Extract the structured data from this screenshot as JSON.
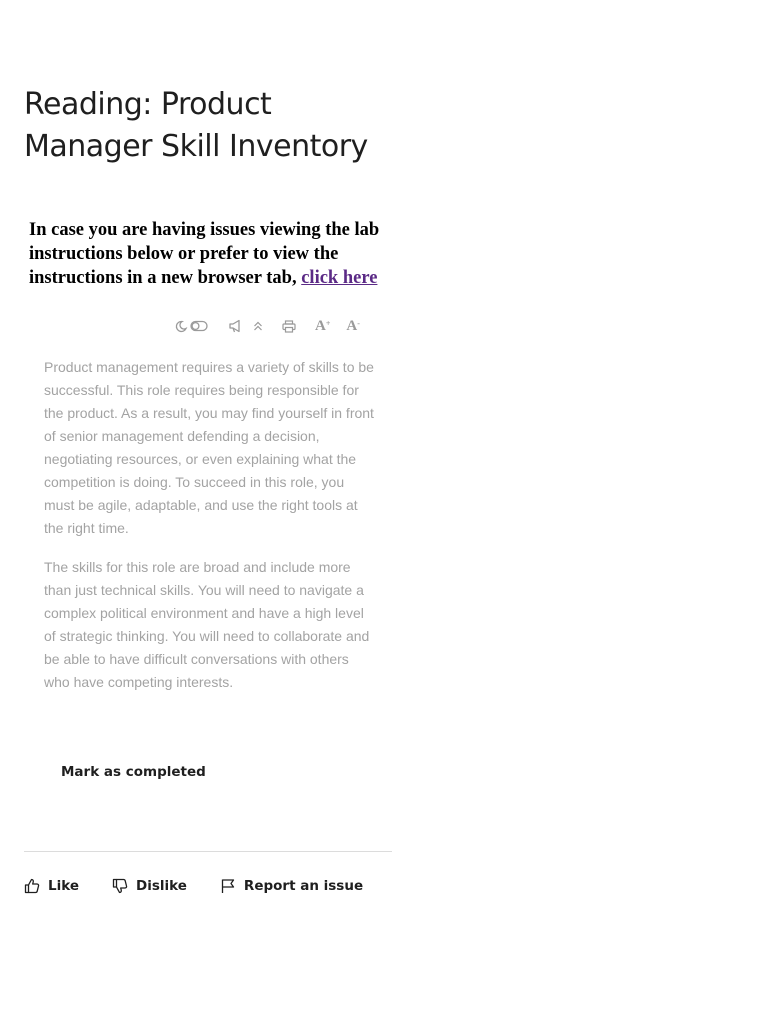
{
  "page": {
    "title": "Reading: Product Manager Skill Inventory"
  },
  "notice": {
    "text": "In case you are having issues viewing the lab instructions below or prefer to view the instructions in a new browser tab, ",
    "link_label": "click here"
  },
  "toolbar": {
    "icons": [
      "dark-mode-toggle-icon",
      "read-aloud-icon",
      "scroll-top-icon",
      "print-icon",
      "increase-font-icon",
      "decrease-font-icon"
    ],
    "font_increase_label": "A",
    "font_increase_sup": "+",
    "font_decrease_label": "A",
    "font_decrease_sup": "-"
  },
  "content": {
    "paragraphs": [
      "Product management requires a variety of skills to be successful. This role requires being responsible for the product. As a result, you may find yourself in front of senior management defending a decision, negotiating resources, or even explaining what the competition is doing. To succeed in this role, you must be agile, adaptable, and use the right tools at the right time.",
      "The skills for this role are broad and include more than just technical skills. You will need to navigate a complex political environment and have a high level of strategic thinking. You will need to collaborate and be able to have difficult conversations with others who have competing interests."
    ]
  },
  "actions": {
    "mark_completed_label": "Mark as completed"
  },
  "feedback": {
    "like_label": "Like",
    "dislike_label": "Dislike",
    "report_label": "Report an issue"
  },
  "colors": {
    "link": "#5b2a86",
    "body_text": "#a3a3a3",
    "heading": "#1f1f1f",
    "toolbar_icon": "#9a9a9a"
  }
}
